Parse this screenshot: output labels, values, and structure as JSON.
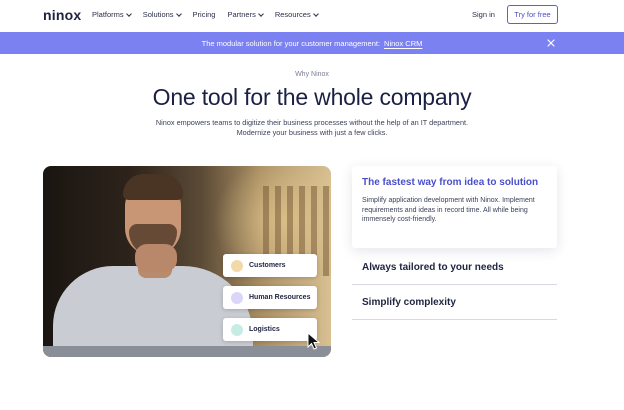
{
  "nav": {
    "logo": "ninox",
    "links": [
      {
        "label": "Platforms",
        "dropdown": true
      },
      {
        "label": "Solutions",
        "dropdown": true
      },
      {
        "label": "Pricing",
        "dropdown": false
      },
      {
        "label": "Partners",
        "dropdown": true
      },
      {
        "label": "Resources",
        "dropdown": true
      }
    ],
    "signin": "Sign in",
    "cta": "Try for free"
  },
  "banner": {
    "text": "The modular solution for your customer management:",
    "link": "Ninox CRM",
    "close_icon": "close-icon",
    "background": "#7c81f2"
  },
  "hero": {
    "eyebrow": "Why Ninox",
    "title": "One tool for the whole company",
    "subtitle_line1": "Ninox empowers teams to digitize their business processes without the help of an IT department.",
    "subtitle_line2": "Modernize your business with just a few clicks."
  },
  "photo_tags": [
    {
      "label": "Customers",
      "icon": "customers-avatar-icon",
      "icon_color": "#f3d9a8"
    },
    {
      "label": "Human Resources",
      "icon": "human-resources-person-icon",
      "icon_color": "#d9d6f7"
    },
    {
      "label": "Logistics",
      "icon": "logistics-avatar-icon",
      "icon_color": "#c6ede3"
    }
  ],
  "features": {
    "active": {
      "title": "The fastest way from idea to solution",
      "body": "Simplify application development with Ninox. Implement requirements and ideas in record time. All while being immensely cost-friendly."
    },
    "items": [
      {
        "title": "Always tailored to your needs"
      },
      {
        "title": "Simplify complexity"
      }
    ]
  },
  "colors": {
    "accent": "#4a4fc9",
    "text": "#1f2440"
  }
}
